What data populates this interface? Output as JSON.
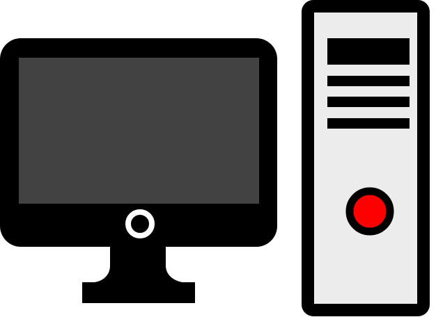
{
  "illustration": {
    "monitor": {
      "icon": "desktop-monitor-icon",
      "frame_color": "#000000",
      "screen_color": "#424242",
      "power_ring_color": "#ffffff"
    },
    "tower": {
      "icon": "pc-tower-icon",
      "outline_color": "#000000",
      "body_color": "#ececec",
      "drive_slot_color": "#000000",
      "power_button_color": "#ff0000"
    }
  }
}
